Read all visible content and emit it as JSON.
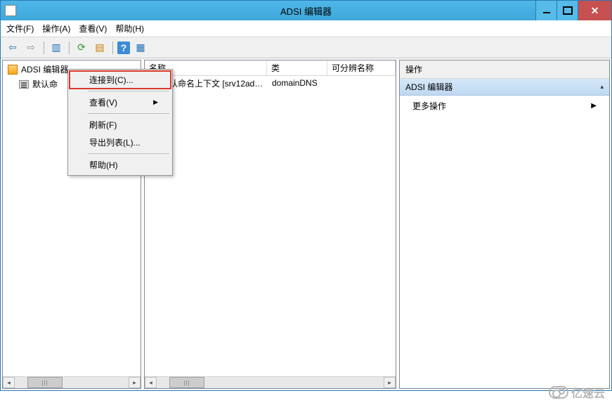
{
  "window": {
    "title": "ADSI 编辑器"
  },
  "menubar": {
    "file": "文件(F)",
    "action": "操作(A)",
    "view": "查看(V)",
    "help": "帮助(H)"
  },
  "toolbar_icons": {
    "back": "back-arrow-icon",
    "forward": "forward-arrow-icon",
    "show_hide": "show-hide-icon",
    "refresh": "refresh-icon",
    "export": "export-icon",
    "help": "help-icon",
    "props": "properties-icon"
  },
  "tree": {
    "root": "ADSI 编辑器",
    "child_partial": "默认命"
  },
  "columns": {
    "name": "名称",
    "class": "类",
    "dn": "可分辨名称"
  },
  "list_row": {
    "name": "认命名上下文 [srv12ad0...",
    "class": "domainDNS",
    "dn": ""
  },
  "actions_pane": {
    "header": "操作",
    "group": "ADSI 编辑器",
    "item": "更多操作"
  },
  "context_menu": {
    "connect": "连接到(C)...",
    "view": "查看(V)",
    "refresh": "刷新(F)",
    "export": "导出列表(L)...",
    "help": "帮助(H)"
  },
  "watermark": "亿速云"
}
